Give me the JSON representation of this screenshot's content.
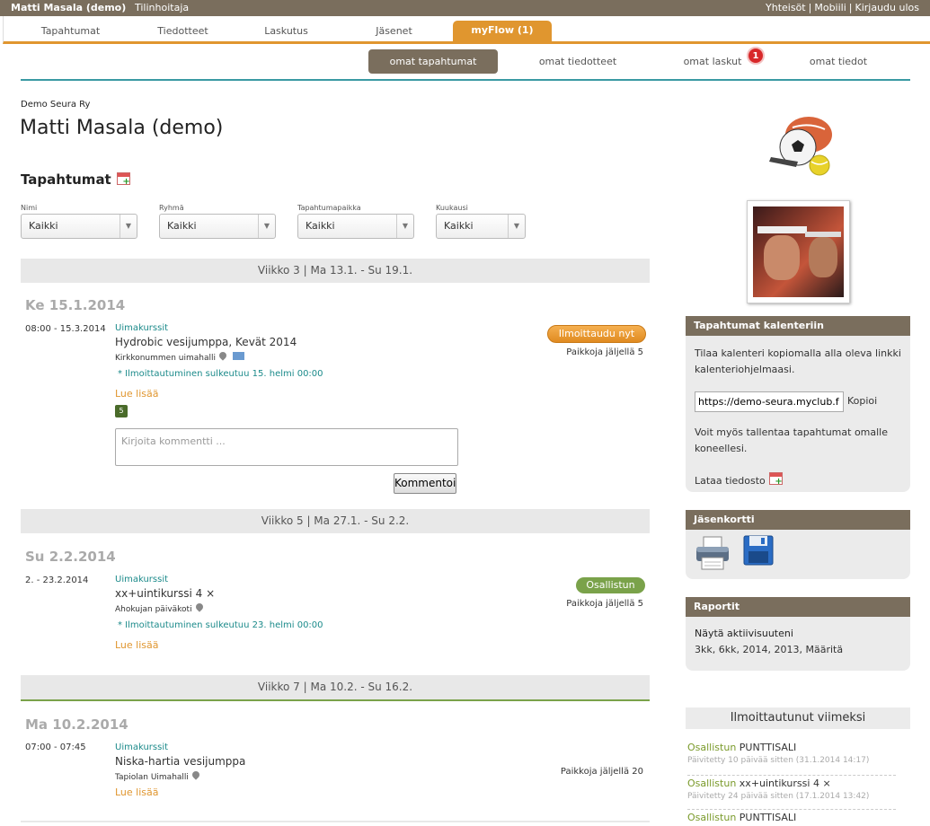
{
  "topbar": {
    "user": "Matti Masala (demo)",
    "manager": "Tilinhoitaja",
    "links": [
      "Yhteisöt",
      "Mobiili",
      "Kirjaudu ulos"
    ]
  },
  "mainnav": [
    "Tapahtumat",
    "Tiedotteet",
    "Laskutus",
    "Jäsenet",
    "myFlow (1)"
  ],
  "subnav": {
    "items": [
      "omat tapahtumat",
      "omat tiedotteet",
      "omat laskut",
      "omat tiedot"
    ],
    "laskut_badge": "1"
  },
  "club": "Demo Seura Ry",
  "page_title": "Matti Masala (demo)",
  "section_title": "Tapahtumat",
  "filters": [
    {
      "label": "Nimi",
      "value": "Kaikki"
    },
    {
      "label": "Ryhmä",
      "value": "Kaikki"
    },
    {
      "label": "Tapahtumapaikka",
      "value": "Kaikki"
    },
    {
      "label": "Kuukausi",
      "value": "Kaikki"
    }
  ],
  "weeks": [
    "Viikko 3 | Ma 13.1. - Su 19.1.",
    "Viikko 5 | Ma 27.1. - Su 2.2.",
    "Viikko 7 | Ma 10.2. - Su 16.2."
  ],
  "events": [
    {
      "day": "Ke 15.1.2014",
      "time": "08:00 - 15.3.2014",
      "category": "Uimakurssit",
      "name": "Hydrobic vesijumppa, Kevät 2014",
      "place": "Kirkkonummen uimahalli",
      "note": "* Ilmoittautuminen sulkeutuu 15. helmi 00:00",
      "more": "Lue lisää",
      "count": "5",
      "action": "Ilmoittaudu nyt",
      "spots": "Paikkoja jäljellä 5",
      "comment_placeholder": "Kirjoita kommentti ...",
      "comment_button": "Kommentoi"
    },
    {
      "day": "Su 2.2.2014",
      "time": "2. - 23.2.2014",
      "category": "Uimakurssit",
      "name": "xx+uintikurssi 4",
      "name_suffix": "×",
      "place": "Ahokujan päiväkoti",
      "note": "* Ilmoittautuminen sulkeutuu 23. helmi 00:00",
      "more": "Lue lisää",
      "action": "Osallistun",
      "spots": "Paikkoja jäljellä 5"
    },
    {
      "day": "Ma 10.2.2014",
      "time": "07:00 - 07:45",
      "category": "Uimakurssit",
      "name": "Niska-hartia vesijumppa",
      "place": "Tapiolan Uimahalli",
      "more": "Lue lisää",
      "spots": "Paikkoja jäljellä 20"
    }
  ],
  "sidebar": {
    "calendar": {
      "title": "Tapahtumat kalenteriin",
      "text": "Tilaa kalenteri kopiomalla alla oleva linkki kalenteriohjelmaasi.",
      "url": "https://demo-seura.myclub.f",
      "copy": "Kopioi",
      "text2": "Voit myös tallentaa tapahtumat omalle koneellesi.",
      "download": "Lataa tiedosto"
    },
    "card": {
      "title": "Jäsenkortti"
    },
    "reports": {
      "title": "Raportit",
      "activity": "Näytä aktiivisuuteni",
      "periods": [
        "3kk",
        "6kk",
        "2014",
        "2013",
        "Määritä"
      ]
    },
    "recent": {
      "title": "Ilmoittautunut viimeksi",
      "items": [
        {
          "status": "Osallistun",
          "name": "PUNTTISALI",
          "date": "Päivitetty 10 päivää sitten (31.1.2014 14:17)"
        },
        {
          "status": "Osallistun",
          "name": "xx+uintikurssi 4 ×",
          "date": "Päivitetty 24 päivää sitten (17.1.2014 13:42)"
        },
        {
          "status": "Osallistun",
          "name": "PUNTTISALI",
          "date": ""
        }
      ]
    }
  },
  "colors": {
    "brown": "#7a6e5d",
    "orange": "#e0962f",
    "teal": "#1b8a8a",
    "green": "#7aa24a",
    "badge_red": "#d8282a"
  }
}
